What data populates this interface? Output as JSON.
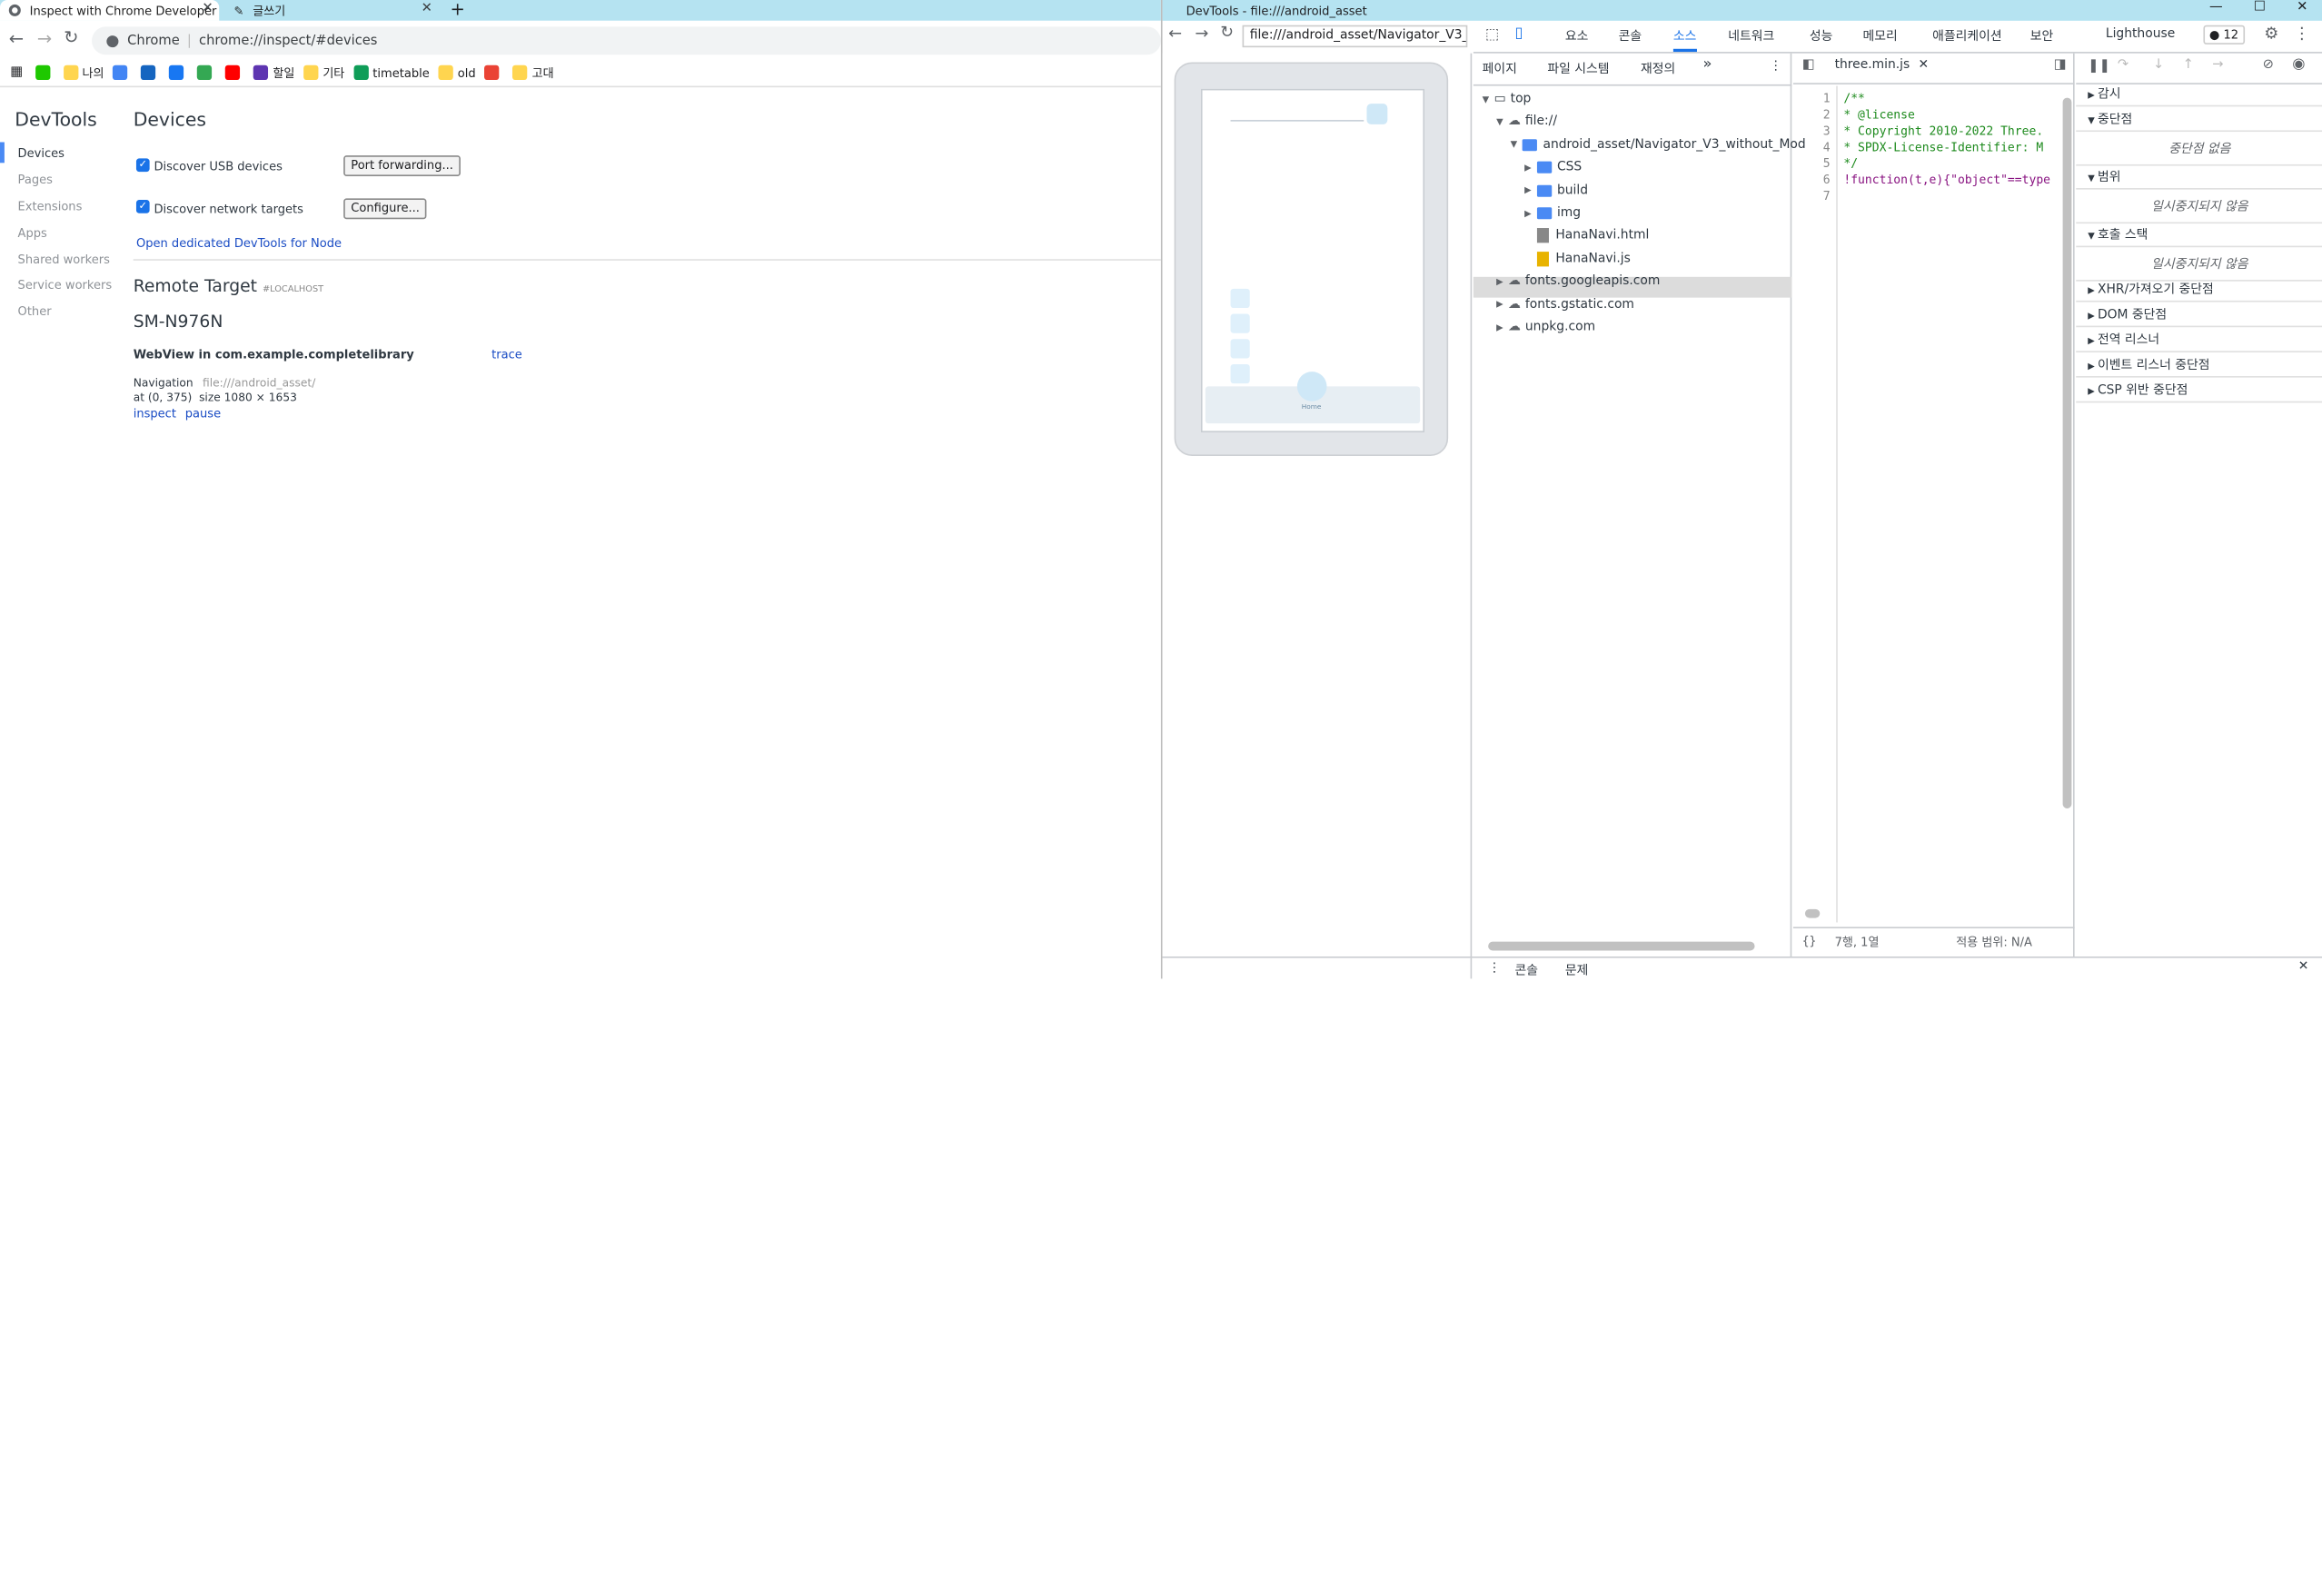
{
  "left_window": {
    "tabs": [
      {
        "title": "Inspect with Chrome Developer"
      },
      {
        "title": "글쓰기"
      }
    ],
    "omnibox": {
      "prefix": "Chrome",
      "url": "chrome://inspect/#devices"
    },
    "bookmarks": [
      {
        "label": "",
        "color": "#1ec800"
      },
      {
        "label": "나의",
        "color": "#ffd54f"
      },
      {
        "label": "",
        "color": "#4285f4"
      },
      {
        "label": "",
        "color": "#1565c0"
      },
      {
        "label": "",
        "color": "#1877f2"
      },
      {
        "label": "",
        "color": "#34a853"
      },
      {
        "label": "",
        "color": "#ff0000"
      },
      {
        "label": "할일",
        "color": "#5e35b1"
      },
      {
        "label": "기타",
        "color": "#ffd54f"
      },
      {
        "label": "timetable",
        "color": "#0f9d58"
      },
      {
        "label": "old",
        "color": "#ffd54f"
      },
      {
        "label": "",
        "color": "#ea4335"
      },
      {
        "label": "고대",
        "color": "#ffd54f"
      }
    ],
    "sidebar": {
      "title": "DevTools",
      "items": [
        "Devices",
        "Pages",
        "Extensions",
        "Apps",
        "Shared workers",
        "Service workers",
        "Other"
      ]
    },
    "devices": {
      "title": "Devices",
      "discover_usb": "Discover USB devices",
      "port_forwarding": "Port forwarding...",
      "discover_network": "Discover network targets",
      "configure": "Configure...",
      "open_node": "Open dedicated DevTools for Node",
      "remote_target": "Remote Target",
      "localhost": "#LOCALHOST",
      "device_name": "SM-N976N",
      "webview": "WebView in com.example.completelibrary",
      "trace": "trace",
      "nav_label": "Navigation",
      "nav_url": "file:///android_asset/",
      "position": "at (0, 375)  size 1080 × 1653",
      "inspect": "inspect",
      "pause": "pause"
    }
  },
  "devtools": {
    "window_title": "DevTools - file:///android_asset",
    "address": "file:///android_asset/Navigator_V3_",
    "main_tabs": [
      "요소",
      "콘솔",
      "소스",
      "네트워크",
      "성능",
      "메모리",
      "애플리케이션",
      "보안",
      "Lighthouse"
    ],
    "issues_count": "12",
    "phone_home": "Home",
    "navigator_tabs": [
      "페이지",
      "파일 시스템",
      "재정의"
    ],
    "tree": [
      {
        "label": "top",
        "indent": 0,
        "kind": "frame"
      },
      {
        "label": "file://",
        "indent": 1,
        "kind": "cloud"
      },
      {
        "label": "android_asset/Navigator_V3_without_Mod",
        "indent": 2,
        "kind": "folder"
      },
      {
        "label": "CSS",
        "indent": 3,
        "kind": "folder"
      },
      {
        "label": "build",
        "indent": 3,
        "kind": "folder"
      },
      {
        "label": "img",
        "indent": 3,
        "kind": "folder"
      },
      {
        "label": "HanaNavi.html",
        "indent": 3,
        "kind": "file-gray"
      },
      {
        "label": "HanaNavi.js",
        "indent": 3,
        "kind": "file-yellow"
      },
      {
        "label": "fonts.googleapis.com",
        "indent": 1,
        "kind": "cloud"
      },
      {
        "label": "fonts.gstatic.com",
        "indent": 1,
        "kind": "cloud"
      },
      {
        "label": "unpkg.com",
        "indent": 1,
        "kind": "cloud"
      }
    ],
    "editor": {
      "file_tab": "three.min.js",
      "lines": [
        {
          "n": "1",
          "text": "/**",
          "color": "#1d8a1d"
        },
        {
          "n": "2",
          "text": " * @license",
          "color": "#1d8a1d"
        },
        {
          "n": "3",
          "text": " * Copyright 2010-2022 Three.",
          "color": "#1d8a1d"
        },
        {
          "n": "4",
          "text": " * SPDX-License-Identifier: M",
          "color": "#1d8a1d"
        },
        {
          "n": "5",
          "text": " */",
          "color": "#1d8a1d"
        },
        {
          "n": "6",
          "text": "!function(t,e){\"object\"==type",
          "color": "#881280"
        },
        {
          "n": "7",
          "text": "",
          "color": "#202124"
        }
      ],
      "status_pos": "7행, 1열",
      "status_scope": "적용 범위: N/A"
    },
    "debugger": {
      "watch": "감시",
      "breakpoints": "중단점",
      "no_breakpoints": "중단점 없음",
      "scope": "범위",
      "not_paused1": "일시중지되지 않음",
      "callstack": "호출 스택",
      "not_paused2": "일시중지되지 않음",
      "xhr": "XHR/가져오기 중단점",
      "dom": "DOM 중단점",
      "global": "전역 리스너",
      "event": "이벤트 리스너 중단점",
      "csp": "CSP 위반 중단점"
    },
    "drawer_tabs": [
      "콘솔",
      "문제"
    ]
  }
}
